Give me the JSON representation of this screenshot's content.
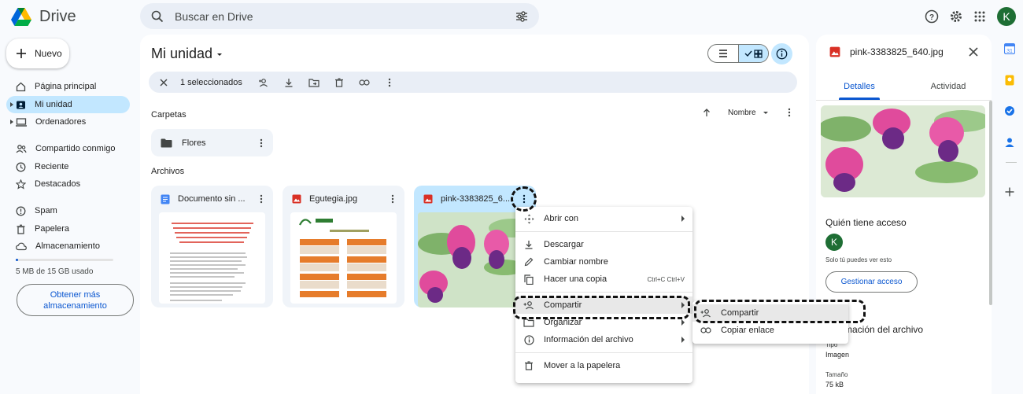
{
  "app": {
    "name": "Drive"
  },
  "search": {
    "placeholder": "Buscar en Drive"
  },
  "header": {
    "avatar_letter": "K"
  },
  "nav": {
    "new_label": "Nuevo",
    "items": [
      {
        "label": "Página principal"
      },
      {
        "label": "Mi unidad"
      },
      {
        "label": "Ordenadores"
      },
      {
        "label": "Compartido conmigo"
      },
      {
        "label": "Reciente"
      },
      {
        "label": "Destacados"
      },
      {
        "label": "Spam"
      },
      {
        "label": "Papelera"
      },
      {
        "label": "Almacenamiento"
      }
    ],
    "storage_used": 0.0033,
    "storage_text": "5 MB de 15 GB usado",
    "storage_button": "Obtener más almacenamiento"
  },
  "main": {
    "title": "Mi unidad",
    "selection_text": "1 seleccionados",
    "folders_heading": "Carpetas",
    "sort_label": "Nombre",
    "folder_name": "Flores",
    "files_heading": "Archivos",
    "files": [
      {
        "name": "Documento sin ...",
        "type": "doc"
      },
      {
        "name": "Egutegia.jpg",
        "type": "image"
      },
      {
        "name": "pink-3383825_6...",
        "type": "image"
      }
    ]
  },
  "context_menu": {
    "items": [
      {
        "label": "Abrir con",
        "icon": "open-with-icon",
        "submenu": true
      },
      {
        "label": "Descargar",
        "icon": "download-icon"
      },
      {
        "label": "Cambiar nombre",
        "icon": "rename-icon"
      },
      {
        "label": "Hacer una copia",
        "icon": "copy-icon",
        "shortcut": "Ctrl+C Ctrl+V"
      },
      {
        "label": "Compartir",
        "icon": "share-icon",
        "submenu": true
      },
      {
        "label": "Organizar",
        "icon": "organize-icon",
        "submenu": true
      },
      {
        "label": "Información del archivo",
        "icon": "info-icon",
        "submenu": true
      },
      {
        "label": "Mover a la papelera",
        "icon": "trash-icon"
      }
    ],
    "submenu": [
      {
        "label": "Compartir",
        "icon": "share-icon"
      },
      {
        "label": "Copiar enlace",
        "icon": "link-icon"
      }
    ]
  },
  "details": {
    "file_name": "pink-3383825_640.jpg",
    "tab_details": "Detalles",
    "tab_activity": "Actividad",
    "access_title": "Quién tiene acceso",
    "avatar_letter": "K",
    "access_note": "Solo tú puedes ver esto",
    "manage_button": "Gestionar acceso",
    "info_title": "Información del archivo",
    "type_label": "Tipo",
    "type_value": "Imagen",
    "size_label": "Tamaño",
    "size_value": "75 kB"
  },
  "colors": {
    "accent": "#0b57d0",
    "selected": "#c2e7ff",
    "surface": "#f0f4f9"
  }
}
